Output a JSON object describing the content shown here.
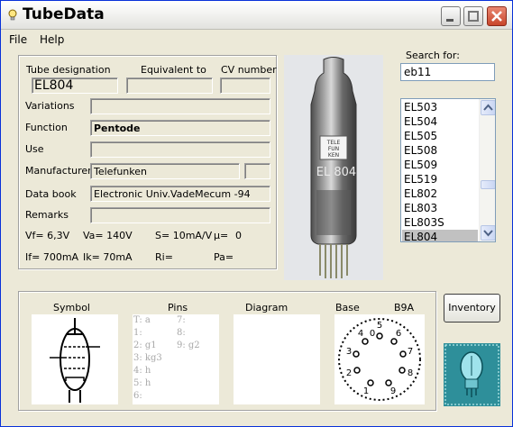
{
  "window": {
    "title": "TubeData"
  },
  "menu": {
    "file": "File",
    "help": "Help"
  },
  "details": {
    "labels": {
      "designation": "Tube designation",
      "equivalent": "Equivalent to",
      "cv": "CV number",
      "variations": "Variations",
      "function": "Function",
      "use": "Use",
      "manufacturer": "Manufacturer",
      "databook": "Data book",
      "remarks": "Remarks"
    },
    "values": {
      "designation": "EL804",
      "equivalent": "",
      "cv": "",
      "variations": "",
      "function": "Pentode",
      "use": "",
      "manufacturer": "Telefunken",
      "manufacturer_extra": "",
      "databook": "Electronic Univ.VadeMecum -94",
      "remarks": ""
    },
    "params": {
      "vf": "Vf= 6,3V",
      "va": "Va= 140V",
      "s": "S= 10mA/V",
      "mu": "µ=",
      "mu_val": "0",
      "if": "If= 700mA",
      "ik": "Ik= 70mA",
      "ri": "Ri=",
      "pa": "Pa="
    }
  },
  "photo": {
    "tube_marking": "EL 804",
    "brand_letters": [
      "TELE",
      "FUN",
      "KEN"
    ]
  },
  "search": {
    "label": "Search for:",
    "value": "eb11"
  },
  "list": {
    "items": [
      "EL503",
      "EL504",
      "EL505",
      "EL508",
      "EL509",
      "EL519",
      "EL802",
      "EL803",
      "EL803S",
      "EL804"
    ],
    "selected": "EL804"
  },
  "bottom": {
    "labels": {
      "symbol": "Symbol",
      "pins": "Pins",
      "diagram": "Diagram",
      "base": "Base",
      "base_type": "B9A"
    },
    "pins": [
      "T: a",
      "1:",
      "2: g1",
      "3: kg3",
      "4: h",
      "5: h",
      "6:",
      "7:",
      "8:",
      "9: g2"
    ],
    "base_pins": [
      "1",
      "2",
      "3",
      "4",
      "5",
      "6",
      "7",
      "8",
      "9",
      "0"
    ]
  },
  "buttons": {
    "inventory": "Inventory"
  },
  "colors": {
    "title_bar": "#f0f0ee",
    "close_button": "#c8452b",
    "selection": "#c1c1c1",
    "frame": "#ece9d8"
  },
  "icons": [
    "bulb-icon",
    "minimize-icon",
    "maximize-icon",
    "close-icon",
    "scroll-up-icon",
    "scroll-down-icon"
  ]
}
